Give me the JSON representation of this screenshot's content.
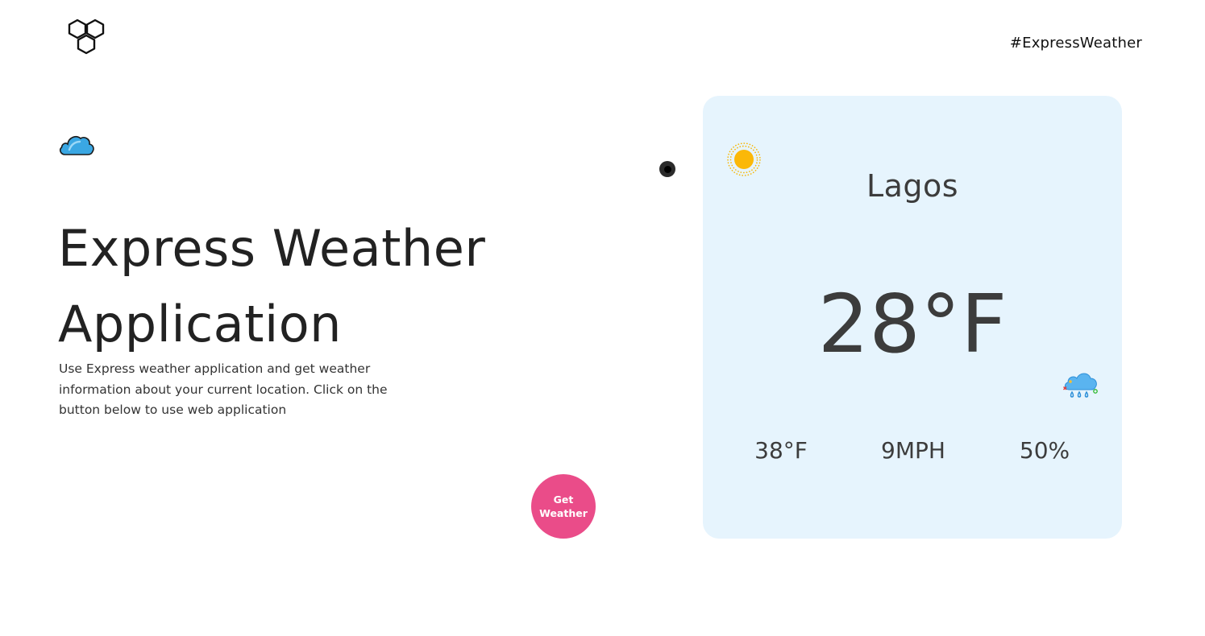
{
  "header": {
    "logo_icon": "hexagon-cluster-icon",
    "hashtag": "#ExpressWeather"
  },
  "hero": {
    "cloud_icon": "cloud-icon",
    "title_line1": "Express Weather",
    "title_line2": "Application",
    "description": "Use Express weather application and get weather information about your current location. Click on the button below to use web application",
    "button_label": "Get Weather"
  },
  "weather_card": {
    "sun_icon": "sun-icon",
    "city": "Lagos",
    "temperature": "28°F",
    "condition_icon": "rain-cloud-icon",
    "stats": [
      "38°F",
      "9MPH",
      "50%"
    ]
  },
  "colors": {
    "accent": "#ea4c89",
    "card_background": "#e6f4fd",
    "text_dark": "#3c3c3c"
  }
}
